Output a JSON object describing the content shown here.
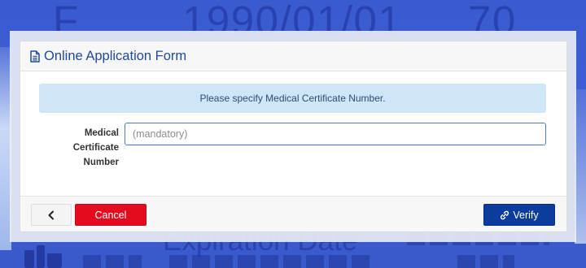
{
  "backdrop": {
    "top_row": [
      "F",
      "1990/01/01",
      "70"
    ],
    "expiration_label": "Expiration Date"
  },
  "dialog": {
    "header": {
      "icon": "document-icon",
      "title": "Online Application Form"
    },
    "alert": {
      "message": "Please specify Medical Certificate Number."
    },
    "form": {
      "medical_certificate": {
        "label": "Medical Certificate Number",
        "value": "",
        "placeholder": "(mandatory)"
      }
    },
    "footer": {
      "back_button": {
        "icon": "chevron-left-icon"
      },
      "cancel_button": {
        "label": "Cancel"
      },
      "verify_button": {
        "icon": "link-icon",
        "label": "Verify"
      }
    }
  },
  "colors": {
    "backdrop": "#3d5dd2",
    "accent": "#214a9a",
    "alert_bg": "#cfe5f8",
    "cancel": "#e60a1e",
    "verify": "#0b3c9e"
  }
}
